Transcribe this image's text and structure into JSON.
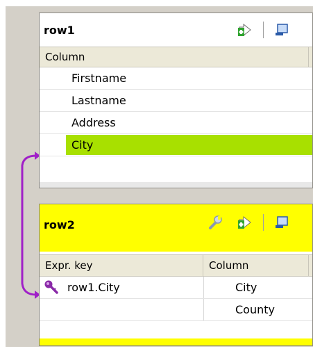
{
  "row1": {
    "title": "row1",
    "column_header": "Column",
    "rows": [
      "Firstname",
      "Lastname",
      "Address",
      "City"
    ],
    "selected_row": "City",
    "icons": [
      "add-input-icon",
      "window-icon"
    ]
  },
  "row2": {
    "title": "row2",
    "headers": {
      "expr_key": "Expr. key",
      "column": "Column"
    },
    "rows": [
      {
        "expr": "row1.City",
        "column": "City",
        "has_key": true
      },
      {
        "expr": "",
        "column": "County",
        "has_key": false
      }
    ],
    "icons": [
      "wrench-icon",
      "add-input-icon",
      "window-icon"
    ]
  },
  "colors": {
    "canvas": "#d4d0c8",
    "highlight": "#a8e000",
    "lookup_header": "#ffff00",
    "link": "#a020c8"
  }
}
